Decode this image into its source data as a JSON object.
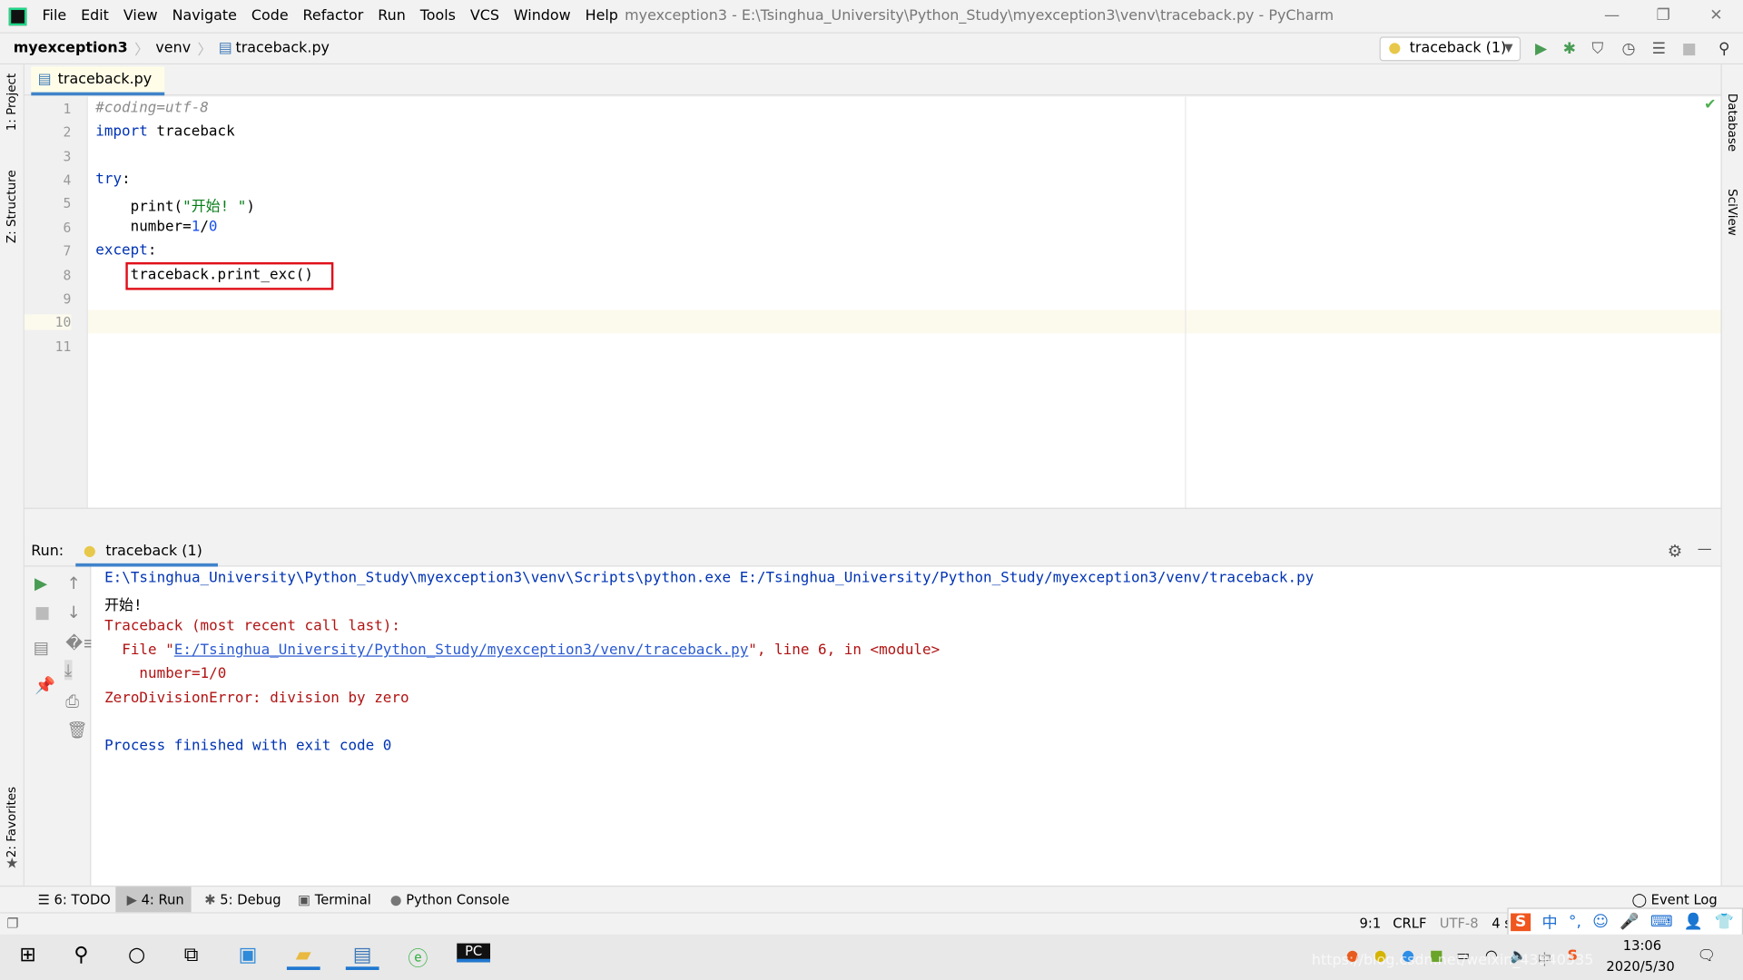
{
  "window": {
    "title": "myexception3 - E:\\Tsinghua_University\\Python_Study\\myexception3\\venv\\traceback.py - PyCharm"
  },
  "menu": [
    "File",
    "Edit",
    "View",
    "Navigate",
    "Code",
    "Refactor",
    "Run",
    "Tools",
    "VCS",
    "Window",
    "Help"
  ],
  "breadcrumb": [
    "myexception3",
    "venv",
    "traceback.py"
  ],
  "toolbar": {
    "run_config": "traceback (1)"
  },
  "left_strip": {
    "project": "1: Project",
    "structure": "Z: Structure",
    "favorites": "2: Favorites"
  },
  "right_strip": {
    "database": "Database",
    "sciview": "SciView"
  },
  "editor": {
    "tab": "traceback.py",
    "current_line": 10,
    "lines": [
      "1",
      "2",
      "3",
      "4",
      "5",
      "6",
      "7",
      "8",
      "9",
      "10",
      "11"
    ],
    "code": {
      "l1": "#coding=utf-8",
      "l2_kw": "import",
      "l2": " traceback",
      "l4_kw": "try",
      "l4": ":",
      "l5a": "    print(",
      "l5s": "\"开始! \"",
      "l5b": ")",
      "l6a": "    number=",
      "l6n1": "1",
      "l6b": "/",
      "l6n2": "0",
      "l7_kw": "except",
      "l7": ":",
      "l8": "    traceback.print_exc()"
    }
  },
  "run": {
    "label": "Run:",
    "tab": "traceback (1)",
    "output": {
      "cmd": "E:\\Tsinghua_University\\Python_Study\\myexception3\\venv\\Scripts\\python.exe E:/Tsinghua_University/Python_Study/myexception3/venv/traceback.py",
      "out1": "开始!",
      "tb": "Traceback (most recent call last):",
      "file_pre": "  File \"",
      "file_link": "E:/Tsinghua_University/Python_Study/myexception3/venv/traceback.py",
      "file_post": "\", line 6, in <module>",
      "src": "    number=1/0",
      "err": "ZeroDivisionError: division by zero",
      "exit": "Process finished with exit code 0"
    }
  },
  "bottom_tabs": [
    "6: TODO",
    "4: Run",
    "5: Debug",
    "Terminal",
    "Python Console"
  ],
  "event_log": "Event Log",
  "status": {
    "position": "9:1",
    "line_sep": "CRLF",
    "encoding": "UTF-8",
    "indent": "4 s"
  },
  "ime": {
    "lang": "中",
    "punct": "°,"
  },
  "taskbar": {
    "time": "13:06",
    "date": "2020/5/30",
    "tray_lang": "中"
  },
  "watermark": "https://blog.csdn.net/weixin_43940535"
}
